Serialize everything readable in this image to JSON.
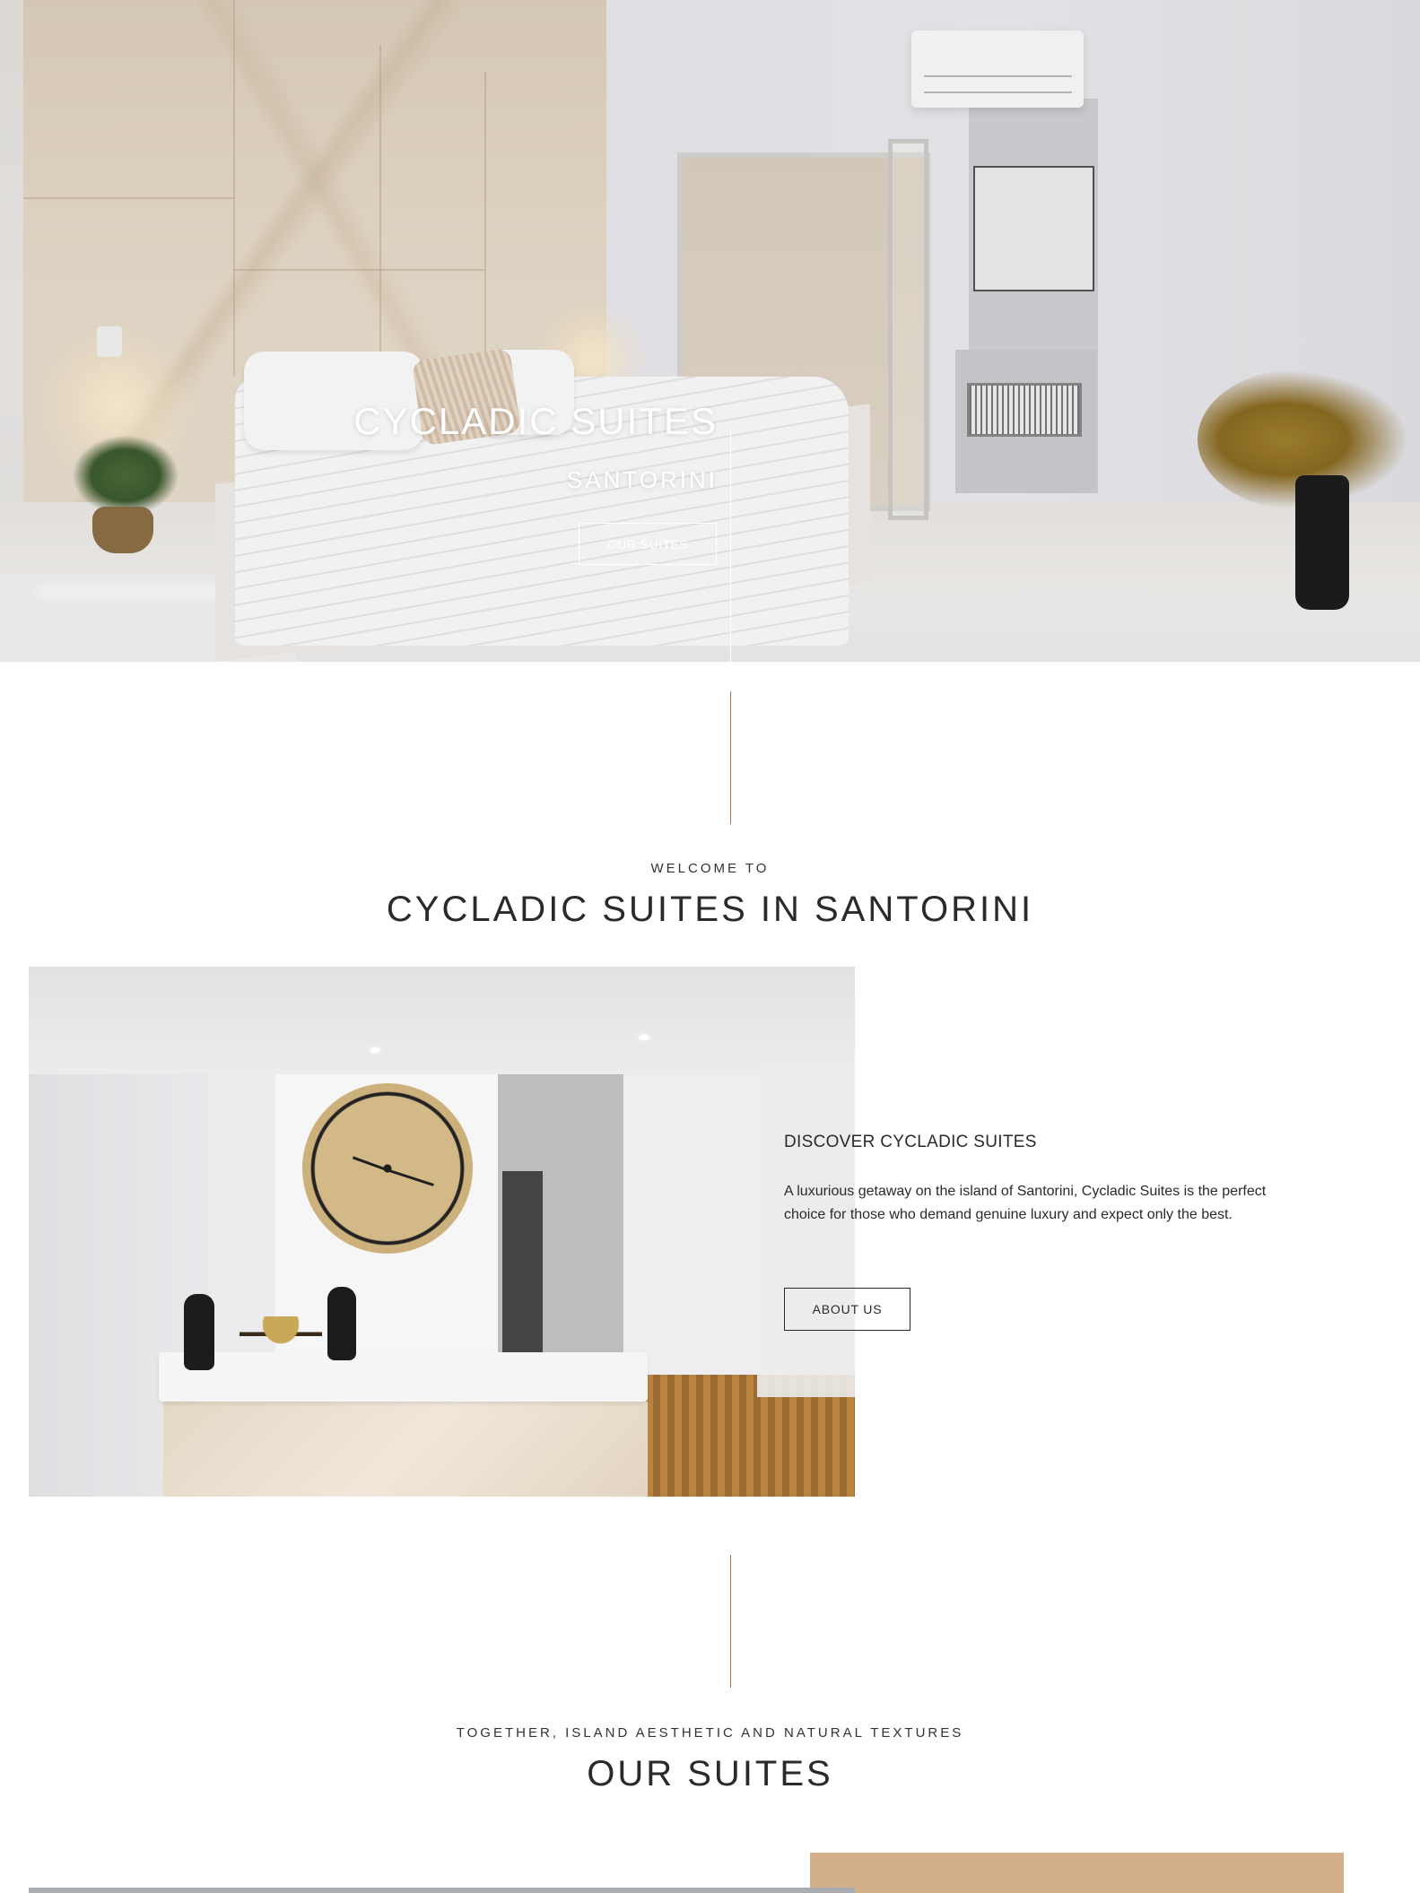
{
  "hero": {
    "title": "CYCLADIC SUITES",
    "subtitle": "SANTORINI",
    "button_label": "OUR SUITES"
  },
  "welcome": {
    "eyebrow": "WELCOME TO",
    "title": "CYCLADIC SUITES IN SANTORINI"
  },
  "about": {
    "heading": "DISCOVER CYCLADIC SUITES",
    "text": "A luxurious getaway on the island of Santorini, Cycladic Suites is the perfect choice for those who demand genuine luxury and expect only the best.",
    "button_label": "ABOUT US"
  },
  "suites": {
    "eyebrow": "TOGETHER, ISLAND AESTHETIC AND NATURAL TEXTURES",
    "title": "OUR SUITES"
  },
  "colors": {
    "accent_line": "#9c7a5c",
    "suite_block": "#d2b08a",
    "text": "#2a2a2a"
  }
}
